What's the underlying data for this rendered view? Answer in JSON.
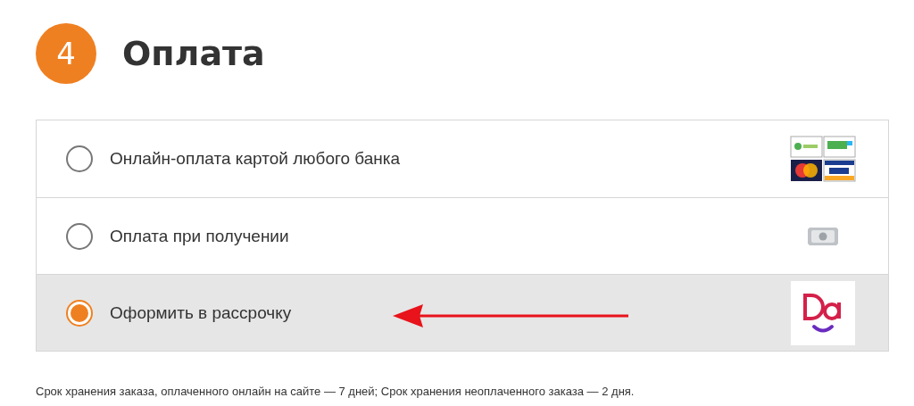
{
  "step": {
    "number": "4",
    "title": "Оплата"
  },
  "options": [
    {
      "label": "Онлайн-оплата картой любого банка",
      "selected": false,
      "kind": "cards"
    },
    {
      "label": "Оплата при получении",
      "selected": false,
      "kind": "cash"
    },
    {
      "label": "Оформить в рассрочку",
      "selected": true,
      "kind": "installment"
    }
  ],
  "note": "Срок хранения заказа, оплаченного онлайн на сайте — 7 дней; Срок хранения неоплаченного заказа — 2 дня."
}
